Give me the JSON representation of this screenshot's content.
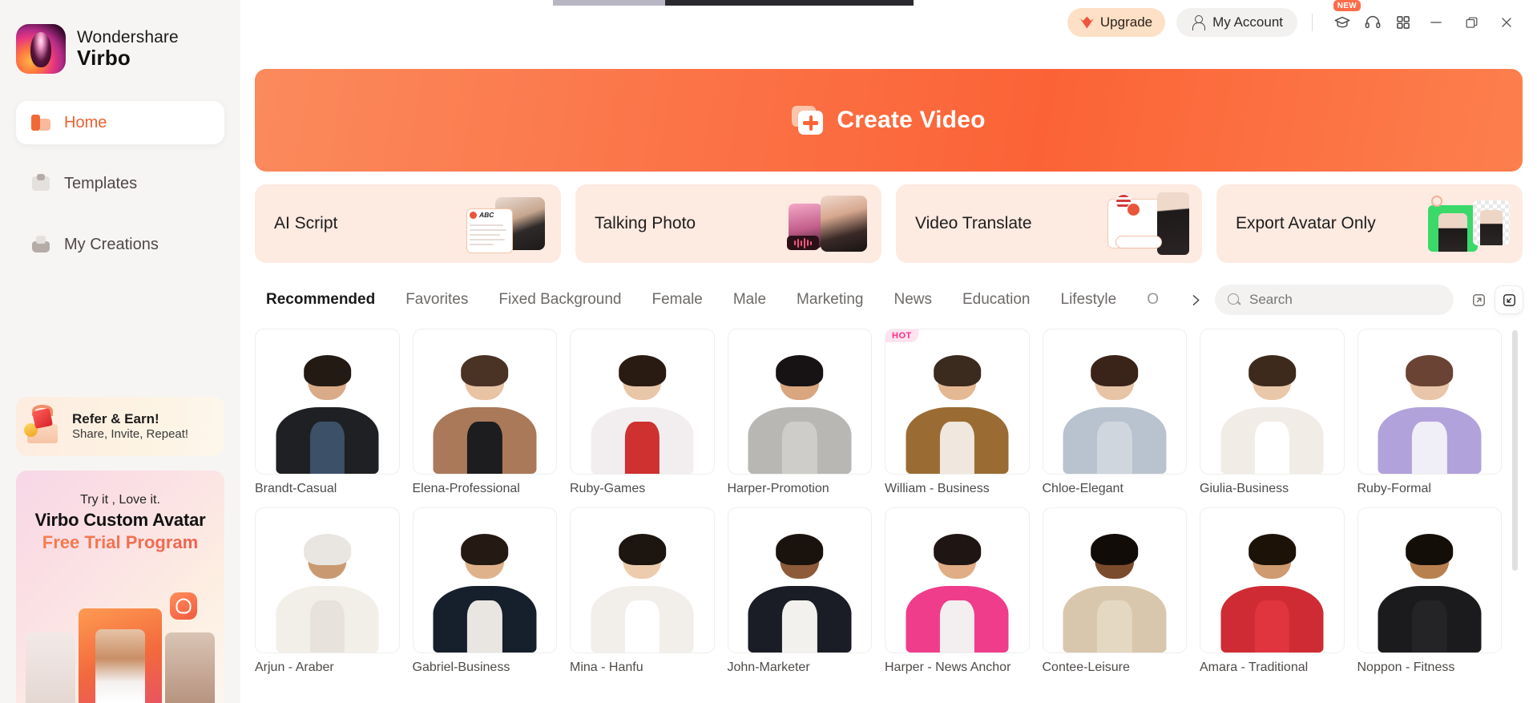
{
  "brand": {
    "company": "Wondershare",
    "product": "Virbo"
  },
  "sidebar": {
    "items": [
      {
        "label": "Home",
        "icon": "home-icon",
        "active": true
      },
      {
        "label": "Templates",
        "icon": "templates-icon",
        "active": false
      },
      {
        "label": "My Creations",
        "icon": "my-creations-icon",
        "active": false
      }
    ],
    "refer_promo": {
      "title": "Refer & Earn!",
      "subtitle": "Share, Invite, Repeat!",
      "icon": "gift-box-icon"
    },
    "avatar_promo": {
      "line1": "Try it , Love it.",
      "line2": "Virbo Custom Avatar",
      "line3": "Free Trial Program"
    }
  },
  "titlebar": {
    "upgrade_label": "Upgrade",
    "upgrade_icon": "crown-icon",
    "account_label": "My Account",
    "account_icon": "user-icon",
    "icons": [
      {
        "name": "graduation-cap-icon",
        "badge": "NEW"
      },
      {
        "name": "headset-support-icon",
        "badge": ""
      },
      {
        "name": "apps-grid-icon",
        "badge": ""
      }
    ],
    "window_controls": [
      {
        "name": "minimize-button"
      },
      {
        "name": "maximize-button"
      },
      {
        "name": "close-button"
      }
    ]
  },
  "banner": {
    "label": "Create Video",
    "icon": "create-video-icon"
  },
  "features": [
    {
      "label": "AI Script",
      "art": "ai-script-art"
    },
    {
      "label": "Talking Photo",
      "art": "talking-photo-art"
    },
    {
      "label": "Video Translate",
      "art": "video-translate-art"
    },
    {
      "label": "Export Avatar Only",
      "art": "export-avatar-art"
    }
  ],
  "tabs": [
    {
      "label": "Recommended",
      "active": true
    },
    {
      "label": "Favorites",
      "active": false
    },
    {
      "label": "Fixed Background",
      "active": false
    },
    {
      "label": "Female",
      "active": false
    },
    {
      "label": "Male",
      "active": false
    },
    {
      "label": "Marketing",
      "active": false
    },
    {
      "label": "News",
      "active": false
    },
    {
      "label": "Education",
      "active": false
    },
    {
      "label": "Lifestyle",
      "active": false
    },
    {
      "label": "Occupation",
      "active": false,
      "clipped": true
    }
  ],
  "tabs_next_icon": "chevron-right-icon",
  "search": {
    "placeholder": "Search",
    "value": "",
    "icon": "search-icon"
  },
  "view_toggles": [
    {
      "name": "expand-view-icon",
      "selected": false
    },
    {
      "name": "collapse-view-icon",
      "selected": true
    }
  ],
  "avatars": [
    {
      "name": "Brandt-Casual",
      "badge": "",
      "skin": "#d9ab88",
      "hair": "#241a14",
      "body": "#1f2023",
      "shirt": "#3c5068"
    },
    {
      "name": "Elena-Professional",
      "badge": "",
      "skin": "#e8c3a4",
      "hair": "#4a3225",
      "body": "#a9795a",
      "shirt": "#1d1c1e"
    },
    {
      "name": "Ruby-Games",
      "badge": "",
      "skin": "#e8c6a8",
      "hair": "#2a1b12",
      "body": "#f2eef0",
      "shirt": "#cf3030"
    },
    {
      "name": "Harper-Promotion",
      "badge": "",
      "skin": "#d9a67f",
      "hair": "#171214",
      "body": "#b9b7b4",
      "shirt": "#cfcdca"
    },
    {
      "name": "William - Business",
      "badge": "HOT",
      "skin": "#e5b894",
      "hair": "#3b2a1e",
      "body": "#9a6c33",
      "shirt": "#f0e7de"
    },
    {
      "name": "Chloe-Elegant",
      "badge": "",
      "skin": "#e7c4a6",
      "hair": "#3a2319",
      "body": "#b9c3cf",
      "shirt": "#cfd6de"
    },
    {
      "name": "Giulia-Business",
      "badge": "",
      "skin": "#e9c8aa",
      "hair": "#3d2a1c",
      "body": "#f1ece6",
      "shirt": "#ffffff"
    },
    {
      "name": "Ruby-Formal",
      "badge": "",
      "skin": "#e9c6a9",
      "hair": "#6a4334",
      "body": "#b2a2db",
      "shirt": "#f0eef7"
    },
    {
      "name": "Arjun - Araber",
      "badge": "",
      "skin": "#c99a72",
      "hair": "#e9e6e1",
      "body": "#f2efe9",
      "shirt": "#e7e3dc"
    },
    {
      "name": "Gabriel-Business",
      "badge": "",
      "skin": "#e0b28c",
      "hair": "#241a13",
      "body": "#16202c",
      "shirt": "#e9e6e2"
    },
    {
      "name": "Mina - Hanfu",
      "badge": "",
      "skin": "#ecccad",
      "hair": "#1d150f",
      "body": "#f2eeea",
      "shirt": "#ffffff"
    },
    {
      "name": "John-Marketer",
      "badge": "",
      "skin": "#8d5b39",
      "hair": "#1a120d",
      "body": "#1a1d26",
      "shirt": "#f3f1ee"
    },
    {
      "name": "Harper - News Anchor",
      "badge": "",
      "skin": "#e0ad86",
      "hair": "#1f1512",
      "body": "#ef3d8b",
      "shirt": "#f3eef0"
    },
    {
      "name": "Contee-Leisure",
      "badge": "",
      "skin": "#7a4b2c",
      "hair": "#120c08",
      "body": "#d9c7ad",
      "shirt": "#e5d8c2"
    },
    {
      "name": "Amara - Traditional",
      "badge": "",
      "skin": "#cf9a6f",
      "hair": "#1c1208",
      "body": "#cf2b34",
      "shirt": "#e0343f"
    },
    {
      "name": "Noppon - Fitness",
      "badge": "",
      "skin": "#b8804f",
      "hair": "#140e09",
      "body": "#1b1b1d",
      "shirt": "#242427"
    }
  ]
}
